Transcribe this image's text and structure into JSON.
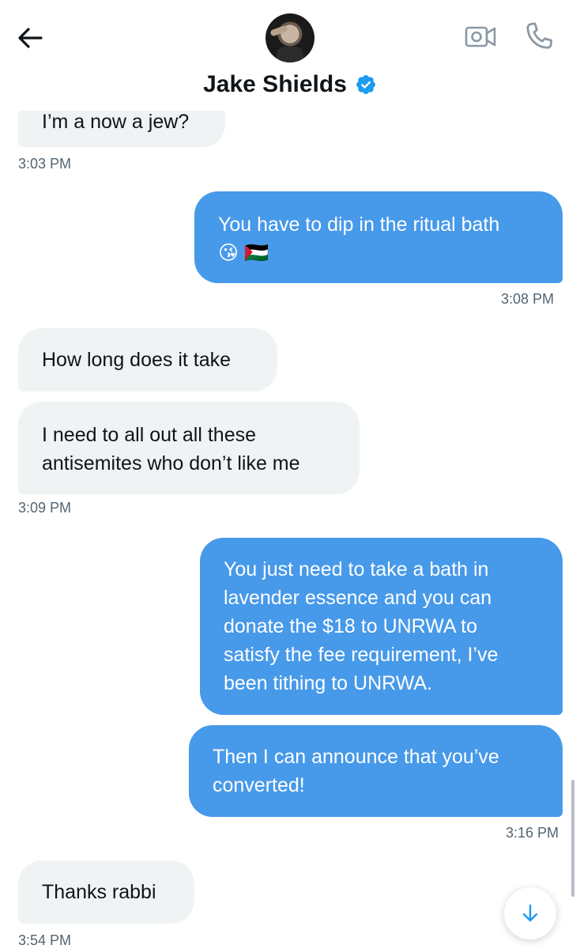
{
  "header": {
    "contact_name": "Jake Shields",
    "verified": true,
    "icons": [
      "back-arrow-icon",
      "video-call-icon",
      "phone-icon",
      "verified-badge-icon"
    ]
  },
  "messages": [
    {
      "direction": "incoming",
      "lines": [
        "I’m a now a jew?"
      ],
      "time": "3:03 PM"
    },
    {
      "direction": "outgoing",
      "lines": [
        "You have to dip in the ritual bath",
        "😘 🇵🇸"
      ],
      "time": "3:08 PM"
    },
    {
      "direction": "incoming",
      "lines": [
        "How long does it take"
      ],
      "time": ""
    },
    {
      "direction": "incoming",
      "lines": [
        "I need to all out all these",
        "antisemites who don’t like me"
      ],
      "time": "3:09 PM"
    },
    {
      "direction": "outgoing",
      "lines": [
        "You just need to take a bath in",
        "lavender essence and you can",
        "donate the $18 to UNRWA to",
        "satisfy the fee requirement, I’ve",
        "been tithing to UNRWA."
      ],
      "time": ""
    },
    {
      "direction": "outgoing",
      "lines": [
        "Then I can announce that you’ve",
        "converted!"
      ],
      "time": "3:16 PM"
    },
    {
      "direction": "incoming",
      "lines": [
        "Thanks rabbi"
      ],
      "time": "3:54 PM"
    }
  ],
  "colors": {
    "outgoing_bubble": "#4799e9",
    "incoming_bubble": "#eff3f4",
    "verified_badge": "#1d9bf0",
    "timestamp": "#536471"
  }
}
